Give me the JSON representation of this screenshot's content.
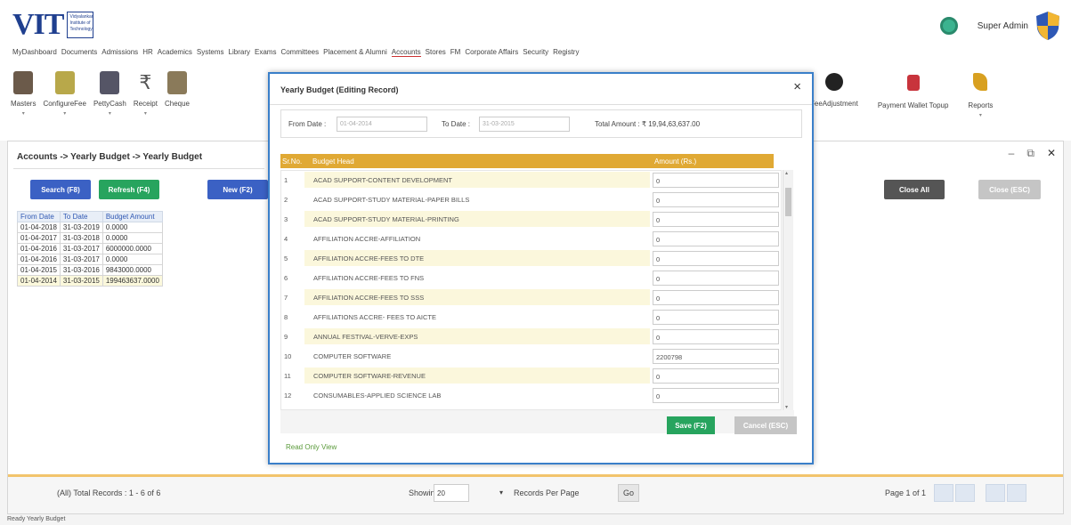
{
  "header": {
    "logo_text": "VIT",
    "logo_sub": "Vidyalankar Institute of Technology",
    "user_name": "Super Admin"
  },
  "menu": [
    "MyDashboard",
    "Documents",
    "Admissions",
    "HR",
    "Academics",
    "Systems",
    "Library",
    "Exams",
    "Committees",
    "Placement & Alumni",
    "Accounts",
    "Stores",
    "FM",
    "Corporate Affairs",
    "Security",
    "Registry"
  ],
  "active_menu": "Accounts",
  "toolbar": {
    "masters": "Masters",
    "configure_fee": "ConfigureFee",
    "petty_cash": "PettyCash",
    "receipt": "Receipt",
    "cheque": "Cheque",
    "fee_adjustment": "FeeAdjustment",
    "payment_wallet_topup": "Payment Wallet Topup",
    "reports": "Reports"
  },
  "panel": {
    "breadcrumb": "Accounts -> Yearly Budget -> Yearly Budget",
    "search_label": "Search (F8)",
    "refresh_label": "Refresh (F4)",
    "new_label": "New (F2)",
    "close_all_label": "Close All",
    "close_esc_label": "Close (ESC)",
    "columns": [
      "From Date",
      "To Date",
      "Budget Amount"
    ],
    "rows": [
      [
        "01-04-2018",
        "31-03-2019",
        "0.0000"
      ],
      [
        "01-04-2017",
        "31-03-2018",
        "0.0000"
      ],
      [
        "01-04-2016",
        "31-03-2017",
        "6000000.0000"
      ],
      [
        "01-04-2016",
        "31-03-2017",
        "0.0000"
      ],
      [
        "01-04-2015",
        "31-03-2016",
        "9843000.0000"
      ],
      [
        "01-04-2014",
        "31-03-2015",
        "199463637.0000"
      ]
    ]
  },
  "footer": {
    "total": "(All) Total Records : 1 - 6 of 6",
    "showing": "Showing",
    "page_size": "20",
    "records_per_page": "Records Per Page",
    "go": "Go",
    "page": "Page 1 of 1"
  },
  "status_bar": "Ready Yearly Budget",
  "modal": {
    "title": "Yearly Budget (Editing Record)",
    "close": "×",
    "from_label": "From Date :",
    "from_value": "01-04-2014",
    "to_label": "To Date :",
    "to_value": "31-03-2015",
    "total_label": "Total Amount : ₹ 19,94,63,637.00",
    "col_no": "Sr.No.",
    "col_head": "Budget Head",
    "col_amount": "Amount (Rs.)",
    "rows": [
      {
        "no": "1",
        "head": "ACAD SUPPORT-CONTENT DEVELOPMENT",
        "amount": "0"
      },
      {
        "no": "2",
        "head": "ACAD SUPPORT-STUDY MATERIAL-PAPER BILLS",
        "amount": "0"
      },
      {
        "no": "3",
        "head": "ACAD SUPPORT-STUDY MATERIAL-PRINTING",
        "amount": "0"
      },
      {
        "no": "4",
        "head": "AFFILIATION ACCRE-AFFILIATION",
        "amount": "0"
      },
      {
        "no": "5",
        "head": "AFFILIATION ACCRE-FEES TO DTE",
        "amount": "0"
      },
      {
        "no": "6",
        "head": "AFFILIATION ACCRE-FEES TO FNS",
        "amount": "0"
      },
      {
        "no": "7",
        "head": "AFFILIATION ACCRE-FEES TO SSS",
        "amount": "0"
      },
      {
        "no": "8",
        "head": "AFFILIATIONS ACCRE- FEES TO AICTE",
        "amount": "0"
      },
      {
        "no": "9",
        "head": "ANNUAL FESTIVAL-VERVE-EXPS",
        "amount": "0"
      },
      {
        "no": "10",
        "head": "COMPUTER SOFTWARE",
        "amount": "2200798"
      },
      {
        "no": "11",
        "head": "COMPUTER SOFTWARE-REVENUE",
        "amount": "0"
      },
      {
        "no": "12",
        "head": "CONSUMABLES-APPLIED SCIENCE LAB",
        "amount": "0"
      }
    ],
    "save_label": "Save (F2)",
    "cancel_label": "Cancel (ESC)",
    "readonly_label": "Read Only View"
  }
}
